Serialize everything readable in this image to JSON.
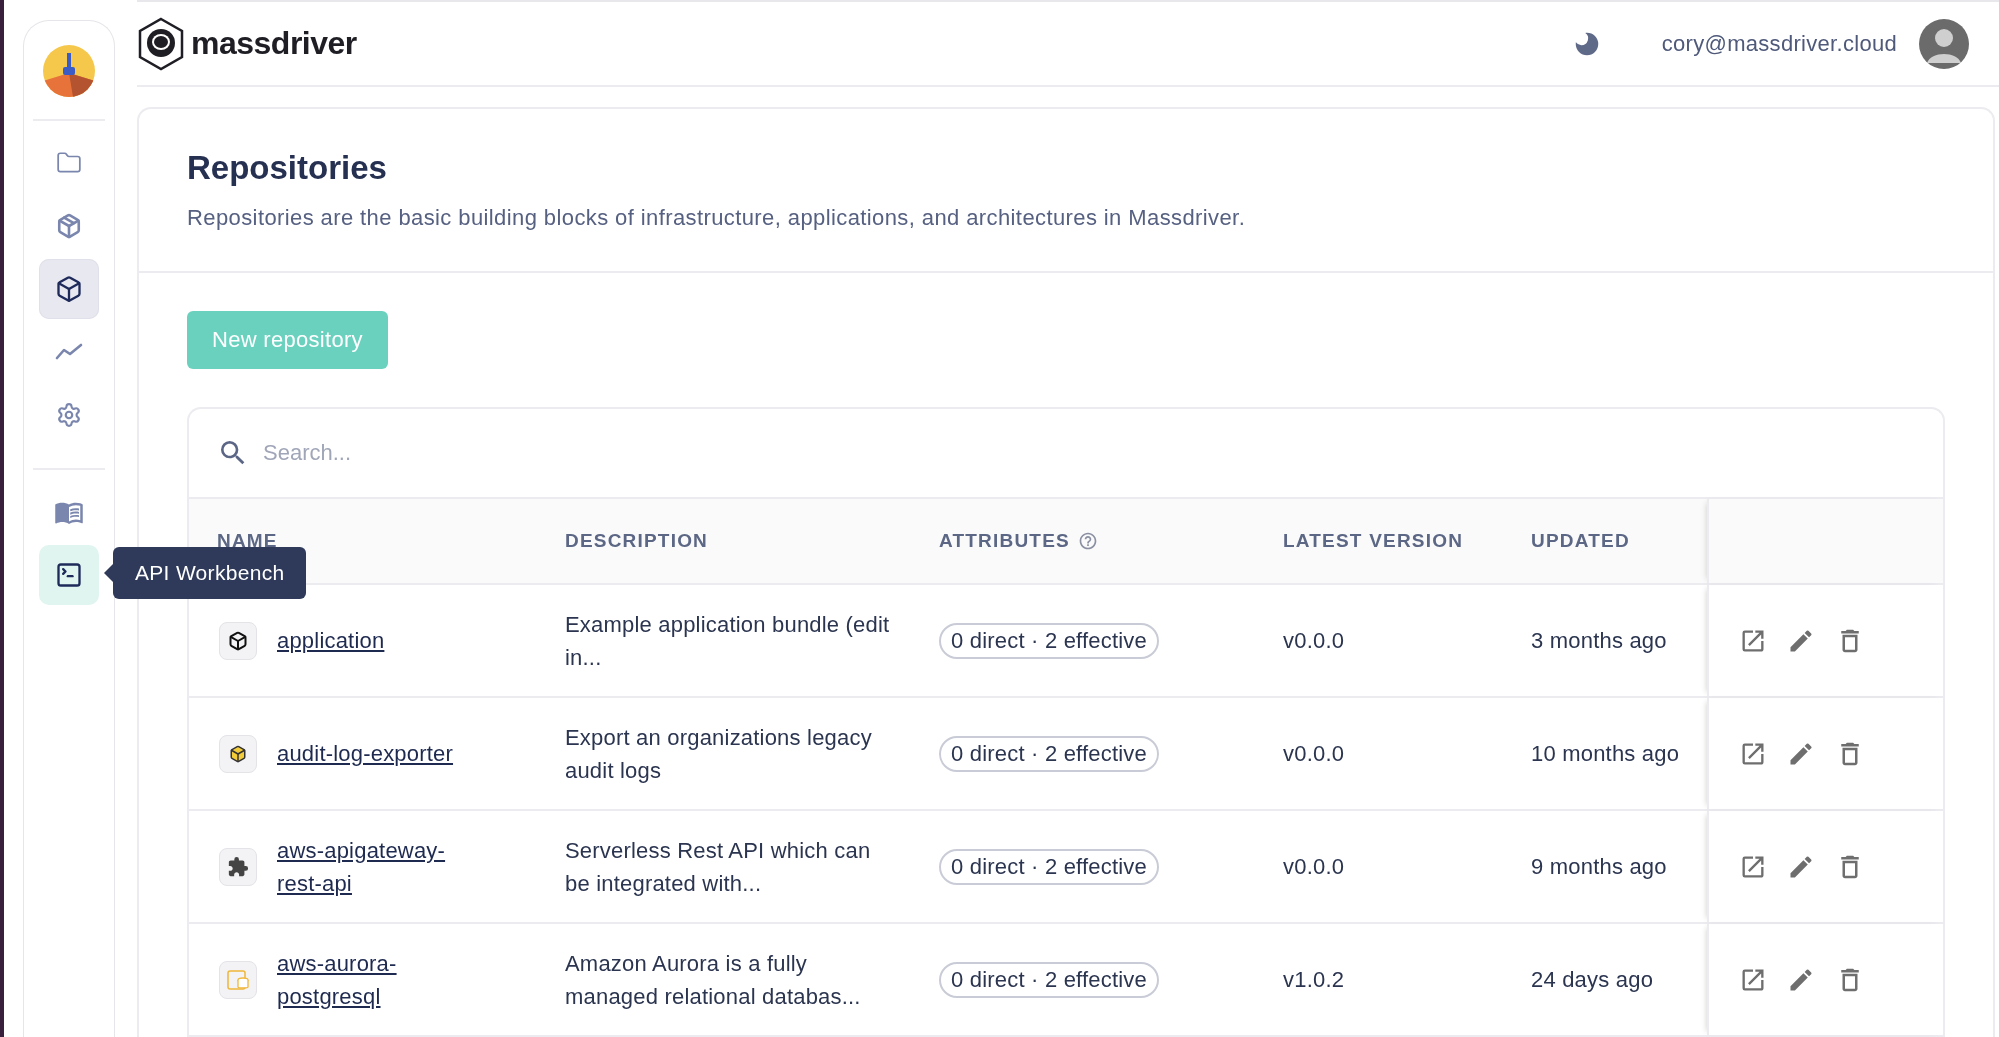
{
  "sidebar": {
    "items": [
      {
        "selected": false,
        "hovered": false
      },
      {
        "selected": false,
        "hovered": false
      },
      {
        "selected": true,
        "hovered": false
      },
      {
        "selected": false,
        "hovered": false
      },
      {
        "selected": false,
        "hovered": false
      },
      {
        "selected": false,
        "hovered": false
      },
      {
        "selected": false,
        "hovered": true
      }
    ],
    "tooltip": "API Workbench"
  },
  "header": {
    "brand": "massdriver",
    "user_email": "cory@massdriver.cloud"
  },
  "page": {
    "title": "Repositories",
    "description": "Repositories are the basic building blocks of infrastructure, applications, and architectures in Massdriver.",
    "new_button": "New repository"
  },
  "table": {
    "search": {
      "placeholder": "Search..."
    },
    "columns": [
      "NAME",
      "DESCRIPTION",
      "ATTRIBUTES",
      "LATEST VERSION",
      "UPDATED"
    ],
    "rows": [
      {
        "name": "application",
        "description": "Example application bundle (edit in...",
        "attributes": "0 direct · 2 effective",
        "version": "v0.0.0",
        "updated": "3 months ago"
      },
      {
        "name": "audit-log-exporter",
        "description": "Export an organizations legacy audit logs",
        "attributes": "0 direct · 2 effective",
        "version": "v0.0.0",
        "updated": "10 months ago"
      },
      {
        "name": "aws-apigateway-rest-api",
        "description": "Serverless Rest API which can be integrated with...",
        "attributes": "0 direct · 2 effective",
        "version": "v0.0.0",
        "updated": "9 months ago"
      },
      {
        "name": "aws-aurora-postgresql",
        "description": "Amazon Aurora is a fully managed relational databas...",
        "attributes": "0 direct · 2 effective",
        "version": "v1.0.2",
        "updated": "24 days ago"
      }
    ]
  }
}
